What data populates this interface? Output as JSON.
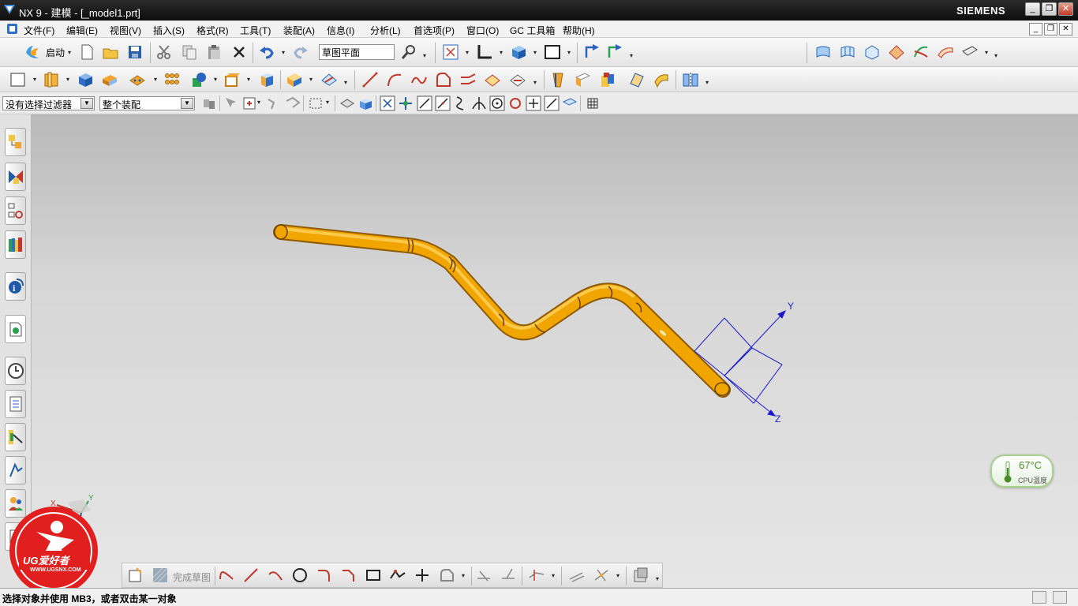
{
  "window": {
    "title": "NX 9 - 建模 - [_model1.prt]",
    "brand": "SIEMENS",
    "controls": [
      "_",
      "❐",
      "✕"
    ]
  },
  "menu": {
    "items": [
      "文件(F)",
      "编辑(E)",
      "视图(V)",
      "插入(S)",
      "格式(R)",
      "工具(T)",
      "装配(A)",
      "信息(I)",
      "分析(L)",
      "首选项(P)",
      "窗口(O)",
      "GC 工具箱",
      "帮助(H)"
    ],
    "doc_controls": [
      "_",
      "❐",
      "✕"
    ]
  },
  "toolbar": {
    "start_label": "启动",
    "sketch_plane_value": "草图平面"
  },
  "selection_bar": {
    "filter_value": "没有选择过滤器",
    "scope_value": "整个装配"
  },
  "viewport": {
    "csys_labels": {
      "y": "Y",
      "z": "Z"
    },
    "triad_labels": {
      "x": "X",
      "y": "Y",
      "z": "Z"
    }
  },
  "cpu_widget": {
    "temperature": "67°C",
    "label": "CPU温度"
  },
  "sketch_toolbar": {
    "finish_label": "完成草图"
  },
  "status": {
    "message": "选择对象并使用 MB3，或者双击某一对象"
  },
  "watermark": {
    "text": "UG爱好者",
    "url": "WWW.UGSNX.COM"
  },
  "colors": {
    "pipe": "#f0a500",
    "csys": "#1a1acc",
    "titlebar": "#1a1a1a"
  }
}
